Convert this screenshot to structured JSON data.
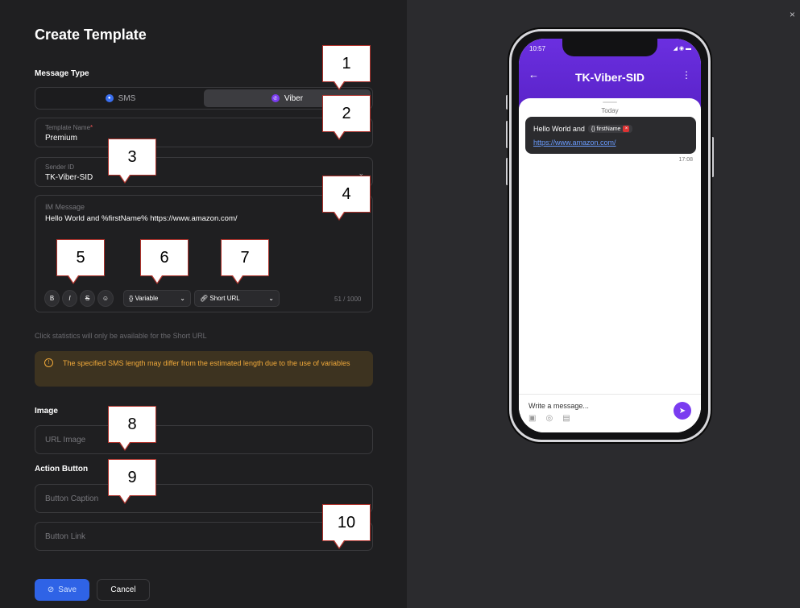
{
  "header": {
    "title": "Create Template",
    "close": "×"
  },
  "message_type": {
    "label": "Message Type",
    "options": [
      {
        "label": "SMS",
        "active": false
      },
      {
        "label": "Viber",
        "active": true
      }
    ]
  },
  "template_name": {
    "label": "Template Name",
    "required_mark": "*",
    "value": "Premium"
  },
  "sender_id": {
    "label": "Sender ID",
    "value": "TK-Viber-SID"
  },
  "im_message": {
    "label": "IM Message",
    "value": "Hello World and %firstName% https://www.amazon.com/",
    "tools": {
      "bold": "B",
      "italic": "I",
      "strike": "S",
      "variable": "{} Variable",
      "short_url": "Short URL"
    },
    "counter": "51 / 1000"
  },
  "hint": "Click statistics will only be available for the Short URL",
  "warning": "The specified SMS length may differ from the estimated length due to the use of variables",
  "image": {
    "label": "Image",
    "placeholder": "URL Image"
  },
  "action_button": {
    "label": "Action Button",
    "caption_placeholder": "Button Caption",
    "link_placeholder": "Button Link"
  },
  "footer": {
    "save": "Save",
    "cancel": "Cancel"
  },
  "callouts": [
    "1",
    "2",
    "3",
    "4",
    "5",
    "6",
    "7",
    "8",
    "9",
    "10"
  ],
  "preview": {
    "time": "10:57",
    "sender": "TK-Viber-SID",
    "date_label": "Today",
    "message_text": "Hello World and",
    "variable_chip": "{} firstName",
    "link": "https://www.amazon.com/",
    "message_time": "17:08",
    "compose_placeholder": "Write a message..."
  },
  "colors": {
    "accent": "#2f63e6",
    "viber": "#7a3cf0",
    "warning": "#f0a93a"
  }
}
